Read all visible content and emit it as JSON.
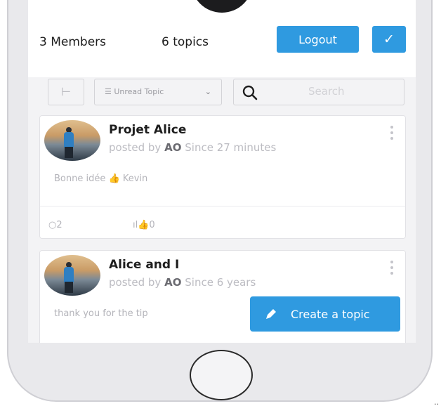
{
  "header": {
    "members": "3 Members",
    "topics": "6 topics",
    "logout_label": "Logout",
    "check_label": "✓"
  },
  "filters": {
    "sort_value": "Unread Topic",
    "search_placeholder": "Search"
  },
  "topics": [
    {
      "title": "Projet Alice",
      "posted_by_prefix": "posted by",
      "author": "AO",
      "since": "Since 27 minutes",
      "excerpt": "Bonne idée",
      "excerpt_emoji": "👍",
      "excerpt_suffix": "Kevin",
      "comments": "2",
      "likes": "0"
    },
    {
      "title": "Alice and I",
      "posted_by_prefix": "posted by",
      "author": "AO",
      "since": "Since 6 years",
      "excerpt": "thank you for the tip"
    }
  ],
  "fab": {
    "label": "Create a topic"
  },
  "corner_mark": "..",
  "colors": {
    "accent": "#2f9ae0"
  },
  "icons": [
    "tree-icon",
    "list-icon",
    "chevron-down-icon",
    "search-icon",
    "more-vertical-icon",
    "comment-icon",
    "thumbs-up-icon",
    "pencil-icon",
    "check-icon"
  ]
}
